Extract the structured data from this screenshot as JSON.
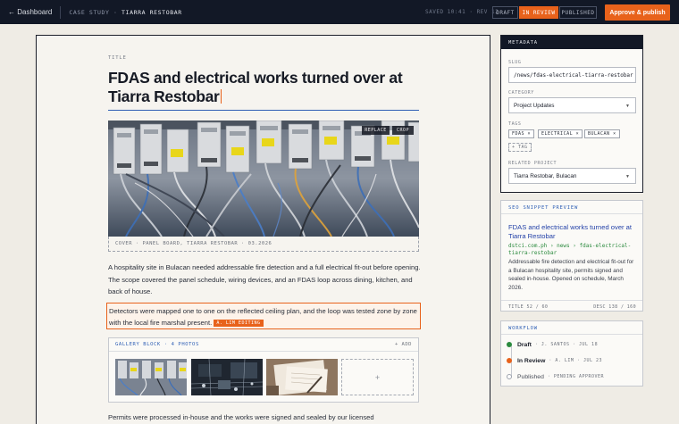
{
  "topbar": {
    "back_label": "← Dashboard",
    "crumb_section": "CASE STUDY ·",
    "crumb_title": "TIARRA RESTOBAR",
    "saved": "SAVED 10:41 · REV 12",
    "status_draft": "DRAFT",
    "status_review": "IN REVIEW",
    "status_published": "PUBLISHED",
    "approve_label": "Approve & publish"
  },
  "editor": {
    "title_label": "TITLE",
    "title": "FDAS and electrical works turned over at Tiarra Restobar",
    "cover": {
      "replace_label": "REPLACE",
      "crop_label": "CROP",
      "caption": "COVER · PANEL BOARD, TIARRA RESTOBAR · 03.2026"
    },
    "paragraph_1": "A hospitality site in Bulacan needed addressable fire detection and a full electrical fit-out before opening. The scope covered the panel schedule, wiring devices, and an FDAS loop across dining, kitchen, and back of house.",
    "paragraph_2": "Detectors were mapped one to one on the reflected ceiling plan, and the loop was tested zone by zone with the local fire marshal present.",
    "editing_tag": "A. LIM EDITING",
    "gallery": {
      "header": "GALLERY BLOCK · 4 PHOTOS",
      "add_label": "+ ADD",
      "add_tile": "+"
    },
    "paragraph_3": "Permits were processed in-house and the works were signed and sealed by our licensed"
  },
  "metadata": {
    "header": "METADATA",
    "slug_label": "SLUG",
    "slug": "/news/fdas-electrical-tiarra-restobar",
    "category_label": "CATEGORY",
    "category": "Project Updates",
    "tags_label": "TAGS",
    "tags": [
      "FDAS ×",
      "ELECTRICAL ×",
      "BULACAN ×"
    ],
    "tag_add": "+ TAG",
    "related_label": "RELATED PROJECT",
    "related": "Tiarra Restobar, Bulacan"
  },
  "seo": {
    "header": "SEO SNIPPET PREVIEW",
    "title": "FDAS and electrical works turned over at Tiarra Restobar",
    "url": "dstci.com.ph › news › fdas-electrical-tiarra-restobar",
    "description": "Addressable fire detection and electrical fit-out for a Bulacan hospitality site, permits signed and sealed in-house. Opened on schedule, March 2026.",
    "title_count": "TITLE 52 / 60",
    "desc_count": "DESC 138 / 160"
  },
  "workflow": {
    "header": "WORKFLOW",
    "steps": [
      {
        "name": "Draft",
        "meta": "· J. SANTOS · JUL 18",
        "color": "#2b8a3e"
      },
      {
        "name": "In Review",
        "meta": "· A. LIM · JUL 23",
        "color": "#e8621b"
      },
      {
        "name": "Published",
        "meta": "· PENDING APPROVER",
        "color": "#ffffff"
      }
    ]
  },
  "colors": {
    "accent": "#e8621b",
    "topbar": "#121826",
    "link": "#2f5fb5"
  }
}
